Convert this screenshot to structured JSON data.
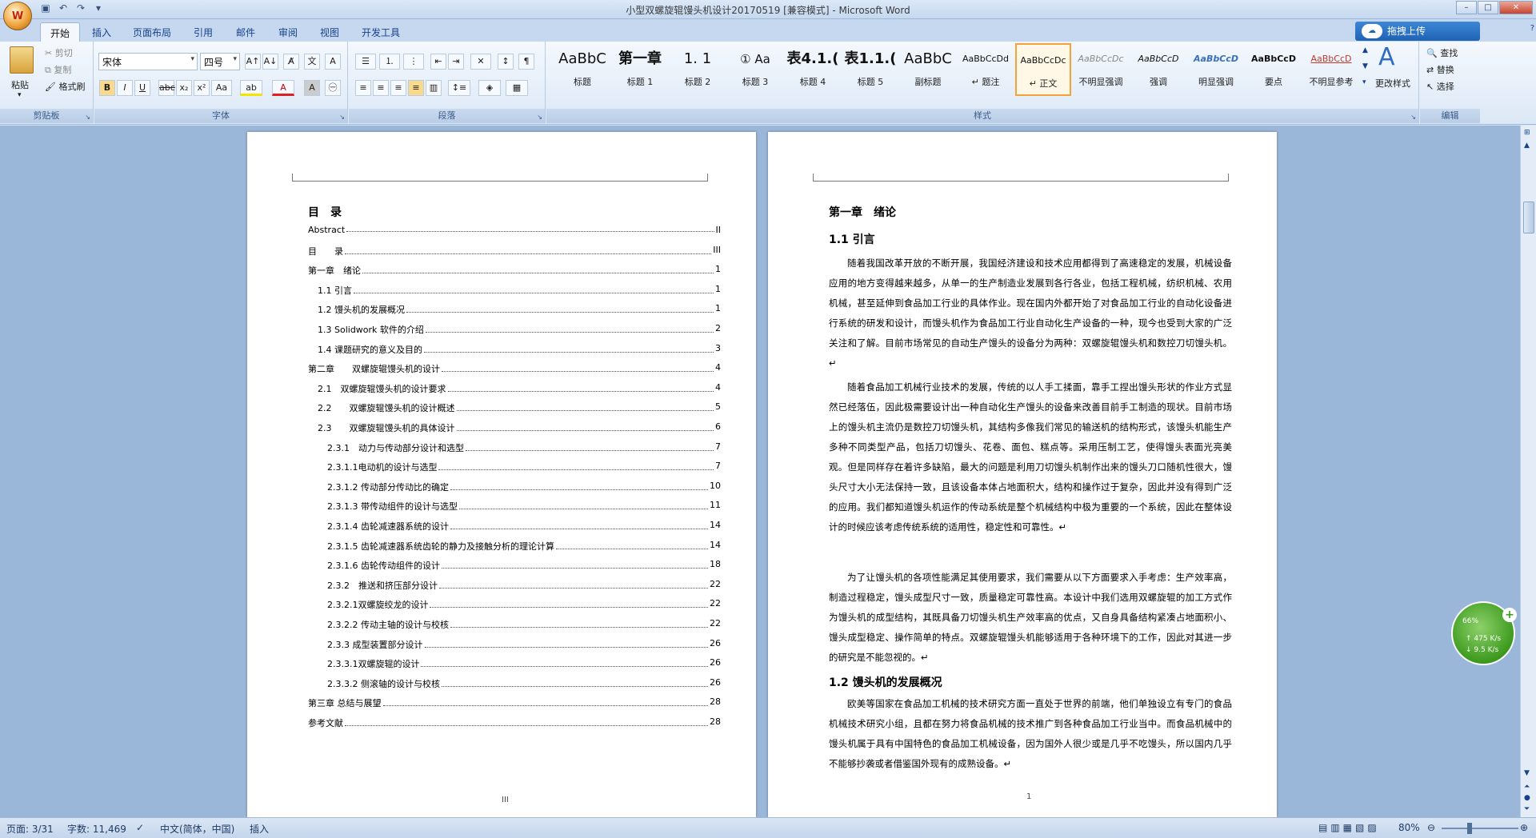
{
  "window": {
    "title": "小型双螺旋辊馒头机设计20170519 [兼容模式] - Microsoft Word",
    "office_button": "W"
  },
  "tabs": [
    "开始",
    "插入",
    "页面布局",
    "引用",
    "邮件",
    "审阅",
    "视图",
    "开发工具"
  ],
  "upload_button": "拖拽上传",
  "ribbon": {
    "clipboard": {
      "label": "剪贴板",
      "paste": "粘贴",
      "cut": "剪切",
      "copy": "复制",
      "format_painter": "格式刷"
    },
    "font": {
      "label": "字体",
      "font_name": "宋体",
      "font_size": "四号"
    },
    "paragraph": {
      "label": "段落"
    },
    "styles": {
      "label": "样式",
      "change_styles": "更改样式",
      "items": [
        {
          "sample": "AaBbC",
          "name": "标题"
        },
        {
          "sample": "第一章",
          "name": "标题 1"
        },
        {
          "sample": "1. 1",
          "name": "标题 2"
        },
        {
          "sample": "① Aa",
          "name": "标题 3"
        },
        {
          "sample": "表4.1.(",
          "name": "标题 4"
        },
        {
          "sample": "表1.1.(",
          "name": "标题 5"
        },
        {
          "sample": "AaBbC",
          "name": "副标题"
        },
        {
          "sample": "AaBbCcDd",
          "name": "↵ 题注"
        },
        {
          "sample": "AaBbCcDc",
          "name": "↵ 正文"
        },
        {
          "sample": "AaBbCcDc",
          "name": "不明显强调"
        },
        {
          "sample": "AaBbCcD",
          "name": "强调"
        },
        {
          "sample": "AaBbCcD",
          "name": "明显强调"
        },
        {
          "sample": "AaBbCcD",
          "name": "要点"
        },
        {
          "sample": "AaBbCcD",
          "name": "不明显参考"
        }
      ]
    },
    "editing": {
      "label": "编辑",
      "find": "查找",
      "replace": "替换",
      "select": "选择"
    }
  },
  "page_left": {
    "heading": "目　录",
    "toc": [
      {
        "label": "Abstract",
        "page": "II"
      },
      {
        "label": "目　　录",
        "page": "III"
      },
      {
        "label": "第一章　绪论",
        "page": "1"
      },
      {
        "label": "1.1  引言",
        "page": "1"
      },
      {
        "label": "1.2 馒头机的发展概况",
        "page": "1"
      },
      {
        "label": "1.3 Solidwork 软件的介绍",
        "page": "2"
      },
      {
        "label": "1.4  课题研究的意义及目的",
        "page": "3"
      },
      {
        "label": "第二章　　双螺旋辊馒头机的设计",
        "page": "4"
      },
      {
        "label": "2.1　双螺旋辊馒头机的设计要求",
        "page": "4"
      },
      {
        "label": "2.2　　双螺旋辊馒头机的设计概述",
        "page": "5"
      },
      {
        "label": "2.3　　双螺旋辊馒头机的具体设计",
        "page": "6"
      },
      {
        "label": "2.3.1　动力与传动部分设计和选型",
        "page": "7"
      },
      {
        "label": "2.3.1.1电动机的设计与选型",
        "page": "7"
      },
      {
        "label": "2.3.1.2  传动部分传动比的确定",
        "page": "10"
      },
      {
        "label": "2.3.1.3 带传动组件的设计与选型",
        "page": "11"
      },
      {
        "label": "2.3.1.4  齿轮减速器系统的设计",
        "page": "14"
      },
      {
        "label": "2.3.1.5  齿轮减速器系统齿轮的静力及接触分析的理论计算",
        "page": "14"
      },
      {
        "label": "2.3.1.6 齿轮传动组件的设计",
        "page": "18"
      },
      {
        "label": "2.3.2　推送和挤压部分设计",
        "page": "22"
      },
      {
        "label": "2.3.2.1双螺旋绞龙的设计",
        "page": "22"
      },
      {
        "label": "2.3.2.2  传动主轴的设计与校核",
        "page": "22"
      },
      {
        "label": "2.3.3 成型装置部分设计",
        "page": "26"
      },
      {
        "label": "2.3.3.1双螺旋辊的设计",
        "page": "26"
      },
      {
        "label": "2.3.3.2 侧滚轴的设计与校核",
        "page": "26"
      },
      {
        "label": "第三章  总结与展望",
        "page": "28"
      },
      {
        "label": "参考文献",
        "page": "28"
      }
    ],
    "page_number": "III"
  },
  "page_right": {
    "chapter_title": "第一章　绪论",
    "section_1_1": "1.1 引言",
    "para1": "随着我国改革开放的不断开展，我国经济建设和技术应用都得到了高速稳定的发展，机械设备应用的地方变得越来越多，从单一的生产制造业发展到各行各业，包括工程机械，纺织机械、农用机械，甚至延伸到食品加工行业的具体作业。现在国内外都开始了对食品加工行业的自动化设备进行系统的研发和设计，而馒头机作为食品加工行业自动化生产设备的一种，现今也受到大家的广泛关注和了解。目前市场常见的自动生产馒头的设备分为两种：双螺旋辊馒头机和数控刀切馒头机。↵",
    "para2": "随着食品加工机械行业技术的发展，传统的以人手工揉面，靠手工捏出馒头形状的作业方式显然已经落伍，因此极需要设计出一种自动化生产馒头的设备来改善目前手工制造的现状。目前市场上的馒头机主流仍是数控刀切馒头机，其结构多像我们常见的输送机的结构形式，该馒头机能生产多种不同类型产品，包括刀切馒头、花卷、面包、糕点等。采用压制工艺，使得馒头表面光亮美观。但是同样存在着许多缺陷，最大的问题是利用刀切馒头机制作出来的馒头刀口随机性很大，馒头尺寸大小无法保持一致，且该设备本体占地面积大，结构和操作过于复杂，因此并没有得到广泛的应用。我们都知道馒头机运作的传动系统是整个机械结构中极为重要的一个系统，因此在整体设计的时候应该考虑传统系统的适用性，稳定性和可靠性。↵",
    "para3": "为了让馒头机的各项性能满足其使用要求，我们需要从以下方面要求入手考虑：生产效率高，制造过程稳定，馒头成型尺寸一致，质量稳定可靠性高。本设计中我们选用双螺旋辊的加工方式作为馒头机的成型结构，其既具备刀切馒头机生产效率高的优点，又自身具备结构紧凑占地面积小、馒头成型稳定、操作简单的特点。双螺旋辊馒头机能够适用于各种环境下的工作，因此对其进一步的研究是不能忽视的。↵",
    "section_1_2": "1.2 馒头机的发展概况",
    "para4": "欧美等国家在食品加工机械的技术研究方面一直处于世界的前端，他们单独设立有专门的食品机械技术研究小组，且都在努力将食品机械的技术推广到各种食品加工行业当中。而食品机械中的馒头机属于具有中国特色的食品加工机械设备，因为国外人很少或是几乎不吃馒头，所以国内几乎不能够抄袭或者借鉴国外现有的成熟设备。↵",
    "page_number": "1"
  },
  "widget": {
    "percent": "66%",
    "up": "475 K/s",
    "down": "9.5 K/s"
  },
  "status": {
    "page": "页面: 3/31",
    "words": "字数: 11,469",
    "language": "中文(简体，中国)",
    "mode": "插入",
    "zoom": "80%"
  }
}
